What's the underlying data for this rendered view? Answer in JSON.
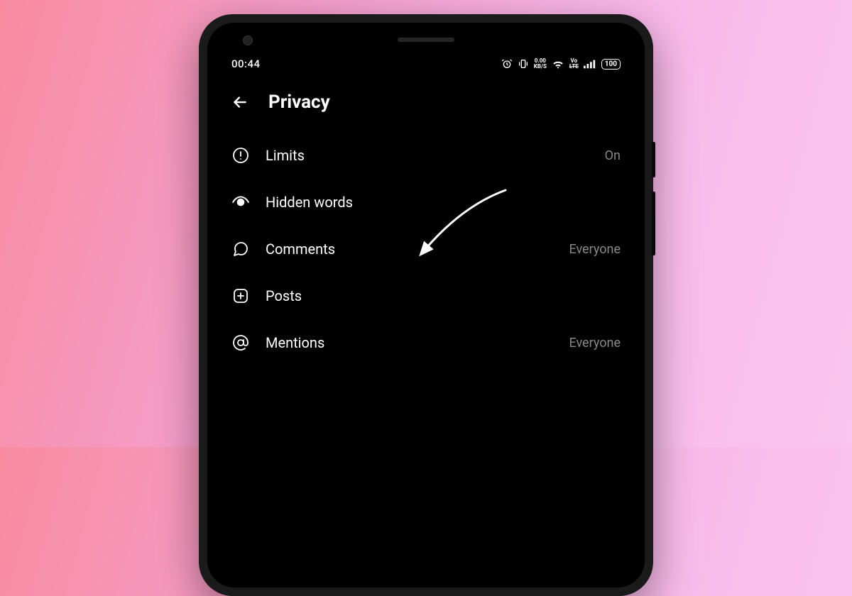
{
  "status_bar": {
    "time": "00:44",
    "net_speed_top": "0.00",
    "net_speed_bottom": "KB/S",
    "volte_top": "Vo",
    "volte_bottom": "LTE",
    "battery": "100"
  },
  "header": {
    "title": "Privacy"
  },
  "menu": [
    {
      "label": "Limits",
      "value": "On"
    },
    {
      "label": "Hidden words",
      "value": ""
    },
    {
      "label": "Comments",
      "value": "Everyone"
    },
    {
      "label": "Posts",
      "value": ""
    },
    {
      "label": "Mentions",
      "value": "Everyone"
    }
  ]
}
